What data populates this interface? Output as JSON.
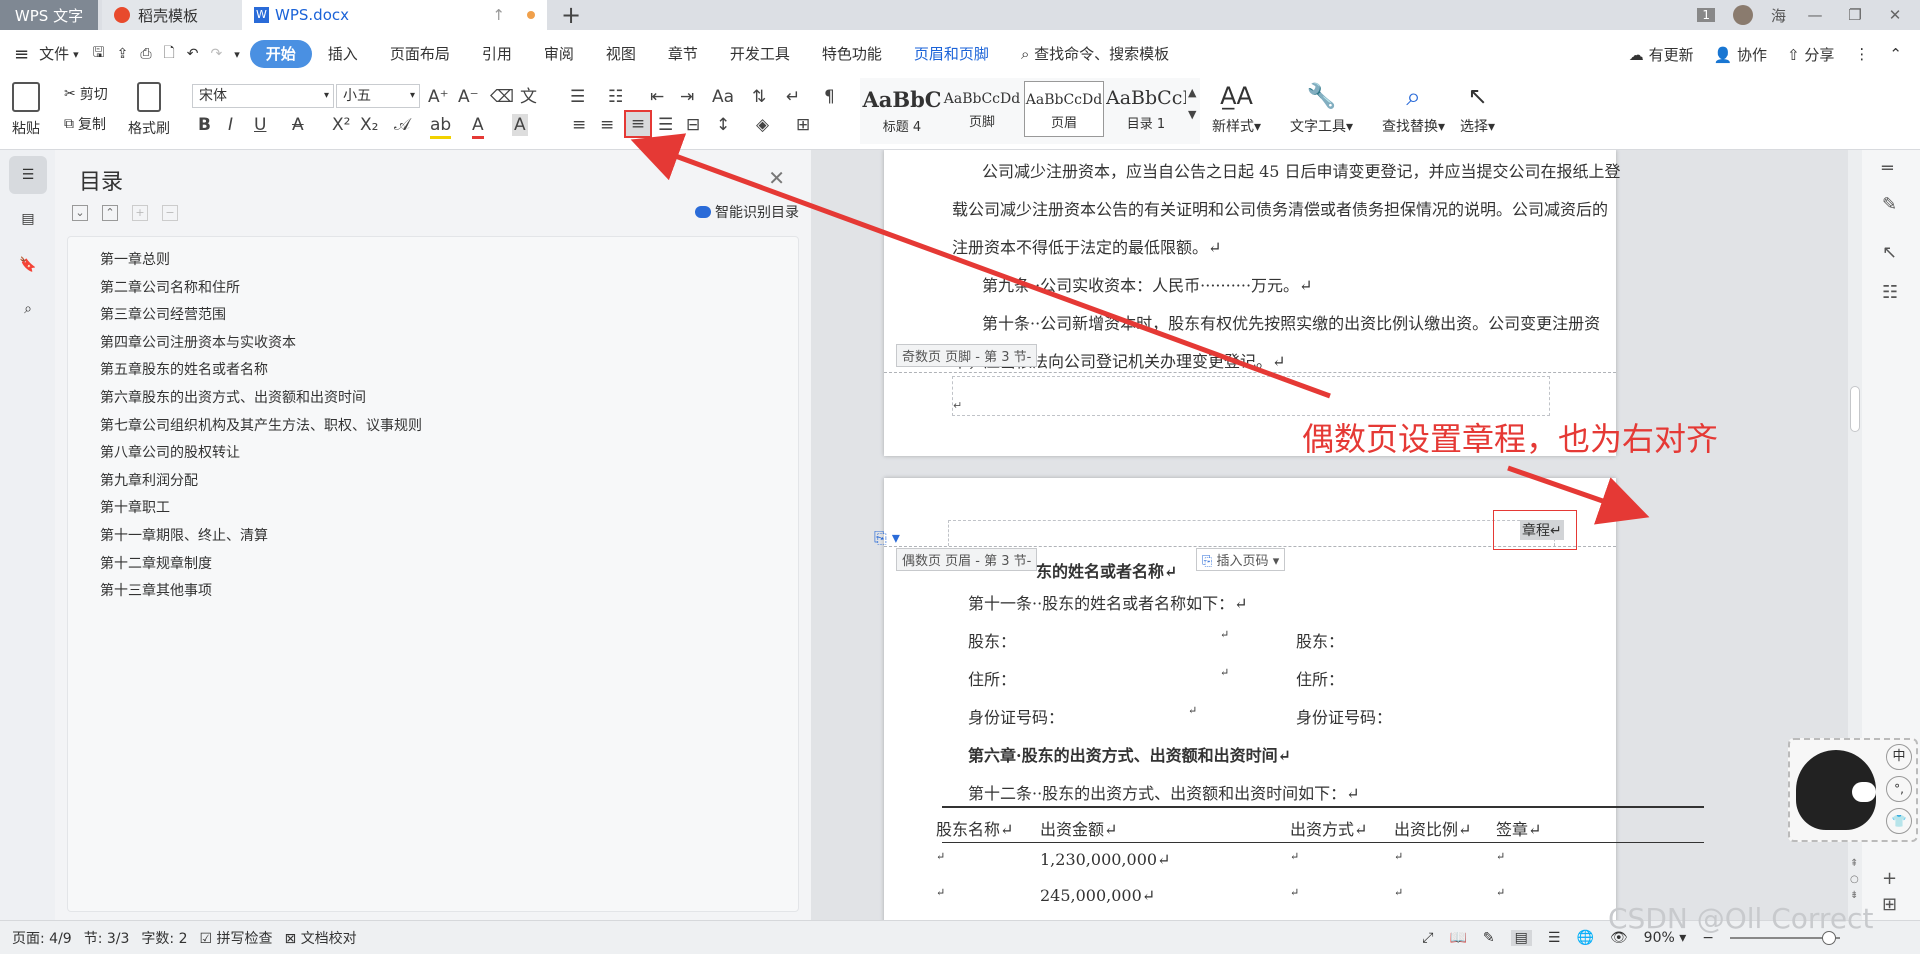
{
  "titlebar": {
    "app_tab": "WPS 文字",
    "template_tab": "稻壳模板",
    "doc_tab": "WPS.docx",
    "badge": "1",
    "user": "海"
  },
  "menubar": {
    "file": "文件",
    "items": [
      "开始",
      "插入",
      "页面布局",
      "引用",
      "审阅",
      "视图",
      "章节",
      "开发工具",
      "特色功能",
      "页眉和页脚"
    ],
    "search": "查找命令、搜索模板",
    "updates": "有更新",
    "collab": "协作",
    "share": "分享"
  },
  "ribbon": {
    "paste": "粘贴",
    "cut": "剪切",
    "copy": "复制",
    "format_painter": "格式刷",
    "font_name": "宋体",
    "font_size": "小五",
    "styles": [
      {
        "sample": "AaBbC",
        "name": "标题 4"
      },
      {
        "sample": "AaBbCcDd",
        "name": "页脚"
      },
      {
        "sample": "AaBbCcDd",
        "name": "页眉"
      },
      {
        "sample": "AaBbCcI",
        "name": "目录 1"
      }
    ],
    "new_style": "新样式",
    "text_tools": "文字工具",
    "find_replace": "查找替换",
    "select": "选择"
  },
  "toc": {
    "title": "目录",
    "smart": "智能识别目录",
    "items": [
      "第一章总则",
      "第二章公司名称和住所",
      "第三章公司经营范围",
      "第四章公司注册资本与实收资本",
      "第五章股东的姓名或者名称",
      "第六章股东的出资方式、出资额和出资时间",
      "第七章公司组织机构及其产生方法、职权、议事规则",
      "第八章公司的股权转让",
      "第九章利润分配",
      "第十章职工",
      "第十一章期限、终止、清算",
      "第十二章规章制度",
      "第十三章其他事项"
    ]
  },
  "doc": {
    "page1_lines": [
      "公司减少注册资本，应当自公告之日起 45 日后申请变更登记，并应当提交公司在报纸上登",
      "载公司减少注册资本公告的有关证明和公司债务清偿或者债务担保情况的说明。公司减资后的",
      "注册资本不得低于法定的最低限额。↵",
      "第九条··公司实收资本：人民币··········万元。↵",
      "第十条··公司新增资本时，股东有权优先按照实缴的出资比例认缴出资。公司变更注册资",
      "本，应当依法向公司登记机关办理变更登记。↵"
    ],
    "odd_footer_tag": "奇数页 页脚 - 第 3 节-",
    "footer_mark": "↵",
    "even_header_tag": "偶数页 页眉 - 第 3 节-",
    "header_text": "章程↵",
    "insert_page_num": "插入页码",
    "heading5": "东的姓名或者名称↵",
    "p11": "第十一条··股东的姓名或者名称如下：↵",
    "shareholder": "股东：",
    "address": "住所：",
    "idcard": "身份证号码：",
    "mark": "↵",
    "heading6": "第六章·股东的出资方式、出资额和出资时间↵",
    "p12": "第十二条··股东的出资方式、出资额和出资时间如下：↵",
    "table_headers": [
      "股东名称↵",
      "出资金额↵",
      "出资方式↵",
      "出资比例↵",
      "签章↵"
    ],
    "table_rows": [
      [
        "↵",
        "1,230,000,000↵",
        "↵",
        "↵",
        "↵"
      ],
      [
        "↵",
        "245,000,000↵",
        "↵",
        "↵",
        "↵"
      ]
    ]
  },
  "annotation": {
    "text": "偶数页设置章程，也为右对齐",
    "color": "#e53935"
  },
  "status": {
    "page": "页面: 4/9",
    "section": "节: 3/3",
    "words": "字数: 2",
    "spell": "拼写检查",
    "proof": "文档校对",
    "zoom": "90%"
  },
  "watermark": "CSDN @Oll Correct",
  "ime": {
    "lang": "中",
    "punct": "°,"
  }
}
